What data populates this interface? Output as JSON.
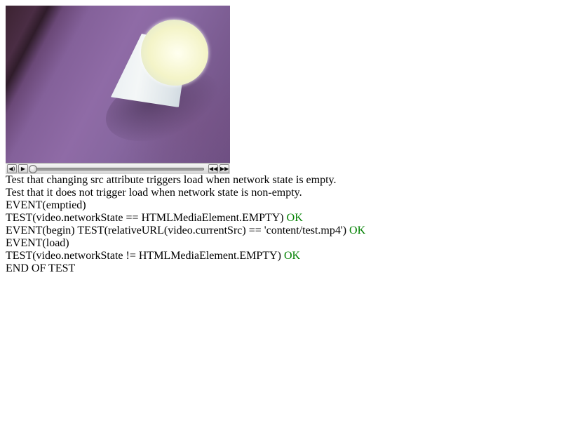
{
  "video": {
    "controls": {
      "volume_icon": "speaker-icon",
      "play_icon": "play-triangle-icon",
      "rewind_icon": "rewind-icon",
      "fullscreen_icon": "forward-icon",
      "progress": 0
    }
  },
  "log": [
    {
      "text": "Test that changing src attribute triggers load when network state is empty.",
      "status": ""
    },
    {
      "text": "Test that it does not trigger load when network state is non-empty.",
      "status": ""
    },
    {
      "text": "EVENT(emptied)",
      "status": ""
    },
    {
      "text": "TEST(video.networkState == HTMLMediaElement.EMPTY) ",
      "status": "OK"
    },
    {
      "text": "EVENT(begin) TEST(relativeURL(video.currentSrc) == 'content/test.mp4') ",
      "status": "OK"
    },
    {
      "text": "EVENT(load)",
      "status": ""
    },
    {
      "text": "TEST(video.networkState != HTMLMediaElement.EMPTY) ",
      "status": "OK"
    },
    {
      "text": "END OF TEST",
      "status": ""
    }
  ],
  "colors": {
    "ok": "#008000"
  }
}
